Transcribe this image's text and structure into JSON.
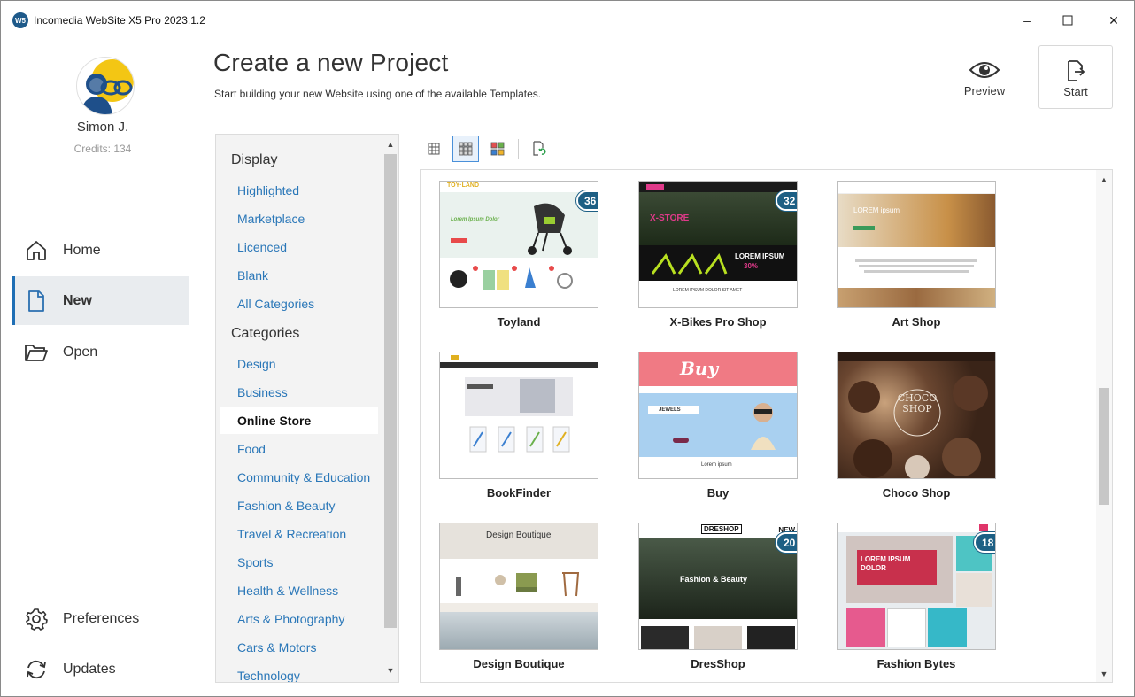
{
  "window": {
    "title": "Incomedia WebSite X5 Pro 2023.1.2",
    "logo_text": "W5",
    "minimize": "–",
    "maximize": "☐",
    "close": "✕"
  },
  "user": {
    "name": "Simon J.",
    "credits": "Credits: 134"
  },
  "nav": {
    "home": "Home",
    "new": "New",
    "open": "Open",
    "preferences": "Preferences",
    "updates": "Updates"
  },
  "header": {
    "title": "Create a new Project",
    "subtitle": "Start building your new Website using one of the available Templates.",
    "preview_label": "Preview",
    "start_label": "Start"
  },
  "categories": {
    "display_heading": "Display",
    "display_items": [
      "Highlighted",
      "Marketplace",
      "Licenced",
      "Blank",
      "All Categories"
    ],
    "categories_heading": "Categories",
    "category_items": [
      "Design",
      "Business",
      "Online Store",
      "Food",
      "Community & Education",
      "Fashion & Beauty",
      "Travel & Recreation",
      "Sports",
      "Health & Wellness",
      "Arts & Photography",
      "Cars & Motors",
      "Technology"
    ],
    "selected": "Online Store"
  },
  "templates": [
    {
      "name": "Toyland",
      "badge": "36 Cr",
      "accent": "#6ab04c"
    },
    {
      "name": "X-Bikes Pro Shop",
      "badge": "32 Cr",
      "accent": "#e03a8a"
    },
    {
      "name": "Art Shop",
      "badge": "",
      "accent": "#c89048"
    },
    {
      "name": "BookFinder",
      "badge": "",
      "accent": "#3a3a3a"
    },
    {
      "name": "Buy",
      "badge": "",
      "accent": "#f0707c"
    },
    {
      "name": "Choco Shop",
      "badge": "",
      "accent": "#5a3b2a"
    },
    {
      "name": "Design Boutique",
      "badge": "",
      "accent": "#9a8a6a"
    },
    {
      "name": "DresShop",
      "badge": "20 Cr",
      "accent": "#222222"
    },
    {
      "name": "Fashion Bytes",
      "badge": "18 Cr",
      "accent": "#e0356a"
    }
  ],
  "thumb_text": {
    "toyland_logo": "TOY·LAND",
    "toyland_hero": "Lorem Ipsum Dolor",
    "xbikes_hero": "X-STORE",
    "xbikes_promo": "LOREM IPSUM",
    "xbikes_promo_pct": "30%",
    "xbikes_bottom": "LOREM IPSUM DOLOR SIT AMET",
    "artshop_hero": "LOREM ipsum",
    "buy_logo": "Buy",
    "buy_label": "JEWELS",
    "buy_footer": "Lorem ipsum",
    "choco_title": "CHOCO SHOP",
    "design_title": "Design Boutique",
    "dres_logo": "DRESHOP",
    "dres_new": "NEW",
    "dres_title": "Fashion & Beauty",
    "fb_title": "LOREM IPSUM DOLOR"
  }
}
